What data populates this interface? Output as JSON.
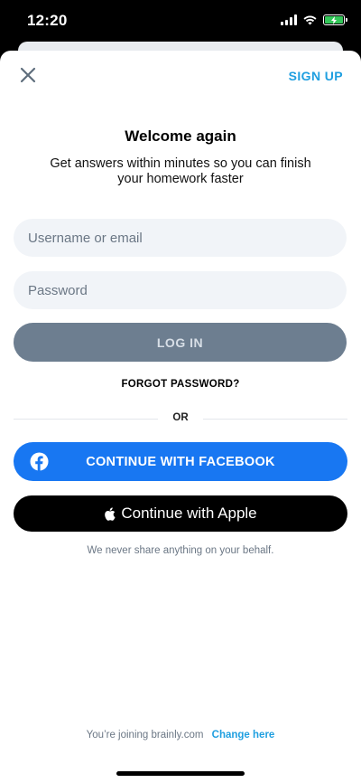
{
  "status_bar": {
    "time": "12:20"
  },
  "header": {
    "signup_label": "SIGN UP"
  },
  "login": {
    "title": "Welcome again",
    "subtitle": "Get answers within minutes so you can finish your homework faster",
    "username_placeholder": "Username or email",
    "password_placeholder": "Password",
    "login_label": "LOG IN",
    "forgot_label": "FORGOT PASSWORD?",
    "or_label": "OR"
  },
  "social": {
    "facebook_label": "CONTINUE WITH FACEBOOK",
    "apple_label": "Continue with Apple",
    "note": "We never share anything on your behalf."
  },
  "footer": {
    "joining_text": "You’re joining brainly.com",
    "change_label": "Change here"
  },
  "colors": {
    "accent": "#1f9fe0",
    "facebook": "#1877f2",
    "login_disabled": "#6d7e90",
    "field_bg": "#f1f4f8",
    "battery": "#34c759"
  }
}
